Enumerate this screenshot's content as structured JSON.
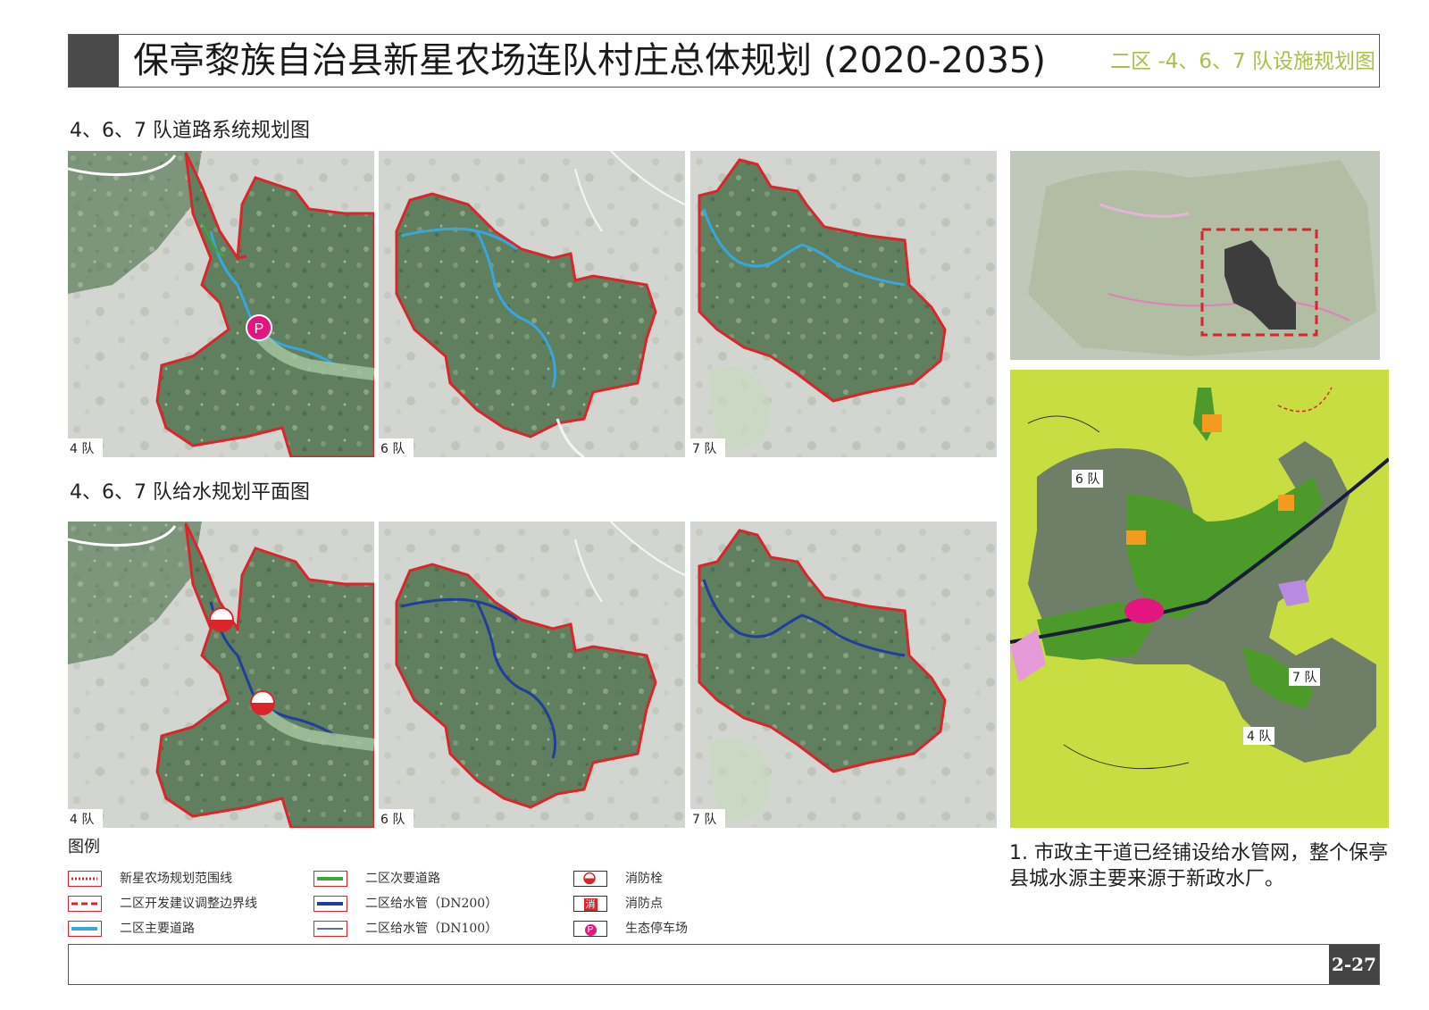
{
  "header": {
    "title": "保亭黎族自治县新星农场连队村庄总体规划 (2020-2035)",
    "subtitle": "二区 -4、6、7 队设施规划图"
  },
  "sections": {
    "road_title": "4、6、7 队道路系统规划图",
    "water_title": "4、6、7 队给水规划平面图"
  },
  "panels": {
    "road": [
      "4 队",
      "6 队",
      "7 队"
    ],
    "water": [
      "4 队",
      "6 队",
      "7 队"
    ]
  },
  "overview_map": {
    "labels": [
      "6 队",
      "7 队",
      "4 队"
    ]
  },
  "legend": {
    "title": "图例",
    "items": [
      {
        "label": "新星农场规划范围线",
        "symbol": "red-dotted-boundary"
      },
      {
        "label": "二区开发建议调整边界线",
        "symbol": "red-dashed-line"
      },
      {
        "label": "二区主要道路",
        "symbol": "light-blue-line"
      },
      {
        "label": "二区次要道路",
        "symbol": "green-line"
      },
      {
        "label": "二区给水管（DN200）",
        "symbol": "navy-thick-line"
      },
      {
        "label": "二区给水管（DN100）",
        "symbol": "navy-thin-line"
      },
      {
        "label": "消防栓",
        "symbol": "hydrant-icon"
      },
      {
        "label": "消防点",
        "symbol": "fire-point-icon",
        "glyph": "消"
      },
      {
        "label": "生态停车场",
        "symbol": "parking-icon",
        "glyph": "P"
      }
    ]
  },
  "parking_glyph": "P",
  "note": "1. 市政主干道已经铺设给水管网，整个保亭县城水源主要来源于新政水厂。",
  "page_number": "2-27",
  "colors": {
    "boundary_red": "#d8262c",
    "main_road_blue": "#39a6dd",
    "water_pipe_navy": "#1f3f9a",
    "secondary_road_green": "#3fa63a",
    "parking_magenta": "#e3157f",
    "subtitle_green": "#a9c04a"
  }
}
